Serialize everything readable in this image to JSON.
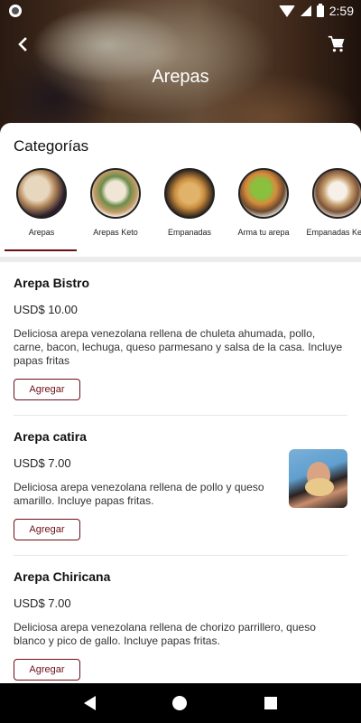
{
  "status_bar": {
    "time": "2:59"
  },
  "header": {
    "title": "Arepas"
  },
  "icons": {
    "back": "arrow-left-icon",
    "cart": "shopping-cart-icon"
  },
  "categories": {
    "title": "Categorías",
    "items": [
      {
        "label": "Arepas",
        "active": true
      },
      {
        "label": "Arepas Keto",
        "active": false
      },
      {
        "label": "Empanadas",
        "active": false
      },
      {
        "label": "Arma tu arepa",
        "active": false
      },
      {
        "label": "Empanadas Keto",
        "active": false
      }
    ]
  },
  "products": [
    {
      "name": "Arepa Bistro",
      "price": "USD$ 10.00",
      "description": "Deliciosa arepa venezolana rellena de chuleta ahumada, pollo, carne, bacon, lechuga, queso parmesano y salsa de la casa. Incluye papas fritas",
      "button": "Agregar"
    },
    {
      "name": "Arepa catira",
      "price": "USD$ 7.00",
      "description": "Deliciosa arepa venezolana rellena de pollo y queso amarillo. Incluye papas fritas.",
      "button": "Agregar"
    },
    {
      "name": "Arepa Chiricana",
      "price": "USD$ 7.00",
      "description": "Deliciosa arepa venezolana rellena de chorizo parrillero, queso blanco y pico de gallo. Incluye papas fritas.",
      "button": "Agregar"
    }
  ],
  "colors": {
    "accent": "#6b0f16"
  }
}
